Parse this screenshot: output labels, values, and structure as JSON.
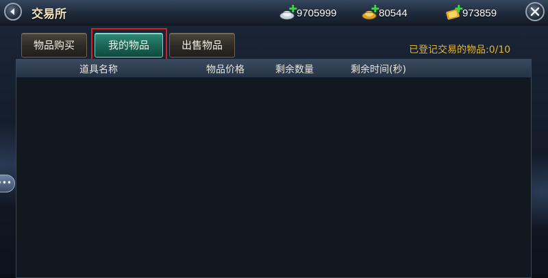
{
  "header": {
    "title": "交易所",
    "currencies": [
      {
        "icon": "silver-ingot-icon",
        "value": "9705999"
      },
      {
        "icon": "gold-ingot-icon",
        "value": "80544"
      },
      {
        "icon": "gold-ticket-icon",
        "value": "973859"
      }
    ]
  },
  "tabs": [
    {
      "label": "物品购买",
      "active": false
    },
    {
      "label": "我的物品",
      "active": true
    },
    {
      "label": "出售物品",
      "active": false
    }
  ],
  "registered_text": "已登记交易的物品:0/10",
  "table": {
    "columns": [
      "道具名称",
      "物品价格",
      "剩余数量",
      "剩余时间(秒)"
    ],
    "rows": []
  },
  "chat_tab": {
    "label": "•••"
  },
  "colors": {
    "active_tab": "#1c6657",
    "highlight_frame": "#d42020",
    "registered_text": "#e6b42a",
    "plus": "#39d93b"
  }
}
